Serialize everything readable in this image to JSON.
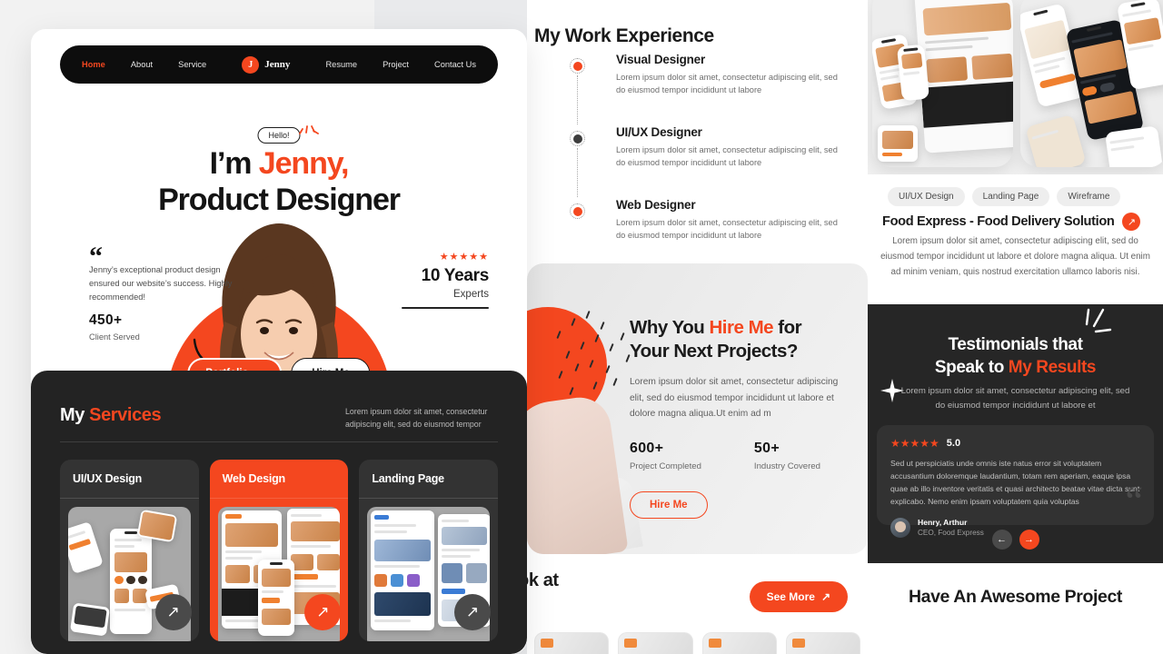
{
  "nav": {
    "left_links": [
      {
        "label": "Home",
        "active": true
      },
      {
        "label": "About",
        "active": false
      },
      {
        "label": "Service",
        "active": false
      }
    ],
    "brand": {
      "initial": "J",
      "name": "Jenny"
    },
    "right_links": [
      {
        "label": "Resume"
      },
      {
        "label": "Project"
      },
      {
        "label": "Contact Us"
      }
    ]
  },
  "hero": {
    "badge": "Hello!",
    "heading_line1_plain": "I’m ",
    "heading_line1_accent": "Jenny,",
    "heading_line2": "Product Designer",
    "testimonial": "Jenny’s exceptional product design ensured our website’s success. Highly recommended!",
    "quote_glyph": "“",
    "clients_number": "450+",
    "clients_label": "Client Served",
    "stars": "★★★★★",
    "years_number": "10 Years",
    "years_label": "Experts",
    "portfolio_button": "Portfolio",
    "portfolio_arrow": "↗",
    "hire_button": "Hire Me"
  },
  "services": {
    "title_plain": "My ",
    "title_accent": "Services",
    "subtitle": "Lorem ipsum dolor sit amet, consectetur adipiscing elit, sed do eiusmod tempor",
    "cards": [
      {
        "title": "UI/UX Design",
        "active": false,
        "arrow": "↗"
      },
      {
        "title": "Web Design",
        "active": true,
        "arrow": "↗"
      },
      {
        "title": "Landing Page",
        "active": false,
        "arrow": "↗"
      }
    ]
  },
  "work": {
    "title": "My Work Experience",
    "items": [
      {
        "role": "Visual Designer",
        "desc": "Lorem ipsum dolor sit amet, consectetur adipiscing elit, sed do eiusmod tempor incididunt ut labore",
        "dot": "orange"
      },
      {
        "role": "UI/UX Designer",
        "desc": "Lorem ipsum dolor sit amet, consectetur adipiscing elit, sed do eiusmod tempor incididunt ut labore",
        "dot": "dark"
      },
      {
        "role": "Web Designer",
        "desc": "Lorem ipsum dolor sit amet, consectetur adipiscing elit, sed do eiusmod tempor incididunt ut labore",
        "dot": "orange"
      }
    ]
  },
  "hire": {
    "heading_a": "Why You ",
    "heading_accent": "Hire Me",
    "heading_b": " for",
    "heading_line2": "Your Next Projects?",
    "desc": "Lorem ipsum dolor sit amet, consectetur adipiscing elit, sed do eiusmod tempor incididunt ut labore et dolore magna aliqua.Ut enim ad m",
    "stats": [
      {
        "number": "600+",
        "label": "Project Completed"
      },
      {
        "number": "50+",
        "label": "Industry Covered"
      }
    ],
    "button": "Hire Me"
  },
  "look": {
    "text": "ok at",
    "see_more": "See More",
    "see_more_arrow": "↗"
  },
  "project": {
    "tags": [
      "UI/UX Design",
      "Landing Page",
      "Wireframe"
    ],
    "title": "Food Express - Food Delivery Solution",
    "title_arrow": "↗",
    "desc": "Lorem ipsum dolor sit amet, consectetur adipiscing elit, sed do eiusmod tempor incididunt ut labore et dolore magna aliqua. Ut enim ad minim veniam, quis nostrud exercitation ullamco laboris nisi."
  },
  "testimonials": {
    "heading_line1": "Testimonials that",
    "heading_line2_plain": "Speak to ",
    "heading_line2_accent": "My Results",
    "subtitle": "Lorem ipsum dolor sit amet, consectetur adipiscing elit, sed do eiusmod tempor incididunt ut labore et",
    "stars": "★★★★★",
    "score": "5.0",
    "text": "Sed ut perspiciatis unde omnis iste natus error sit voluptatem accusantium doloremque laudantium, totam rem aperiam, eaque ipsa quae ab illo inventore veritatis et quasi architecto beatae vitae dicta sunt explicabo. Nemo enim ipsam voluptatem quia voluptas",
    "author_name": "Henry, Arthur",
    "author_role": "CEO, Food Express",
    "quote_glyph": "“",
    "prev_arrow": "←",
    "next_arrow": "→"
  },
  "awesome": {
    "title": "Have An Awesome Project"
  },
  "colors": {
    "accent": "#f4471f",
    "dark": "#232323",
    "near_black": "#0d0d0d",
    "page_bg": "#ffffff"
  }
}
